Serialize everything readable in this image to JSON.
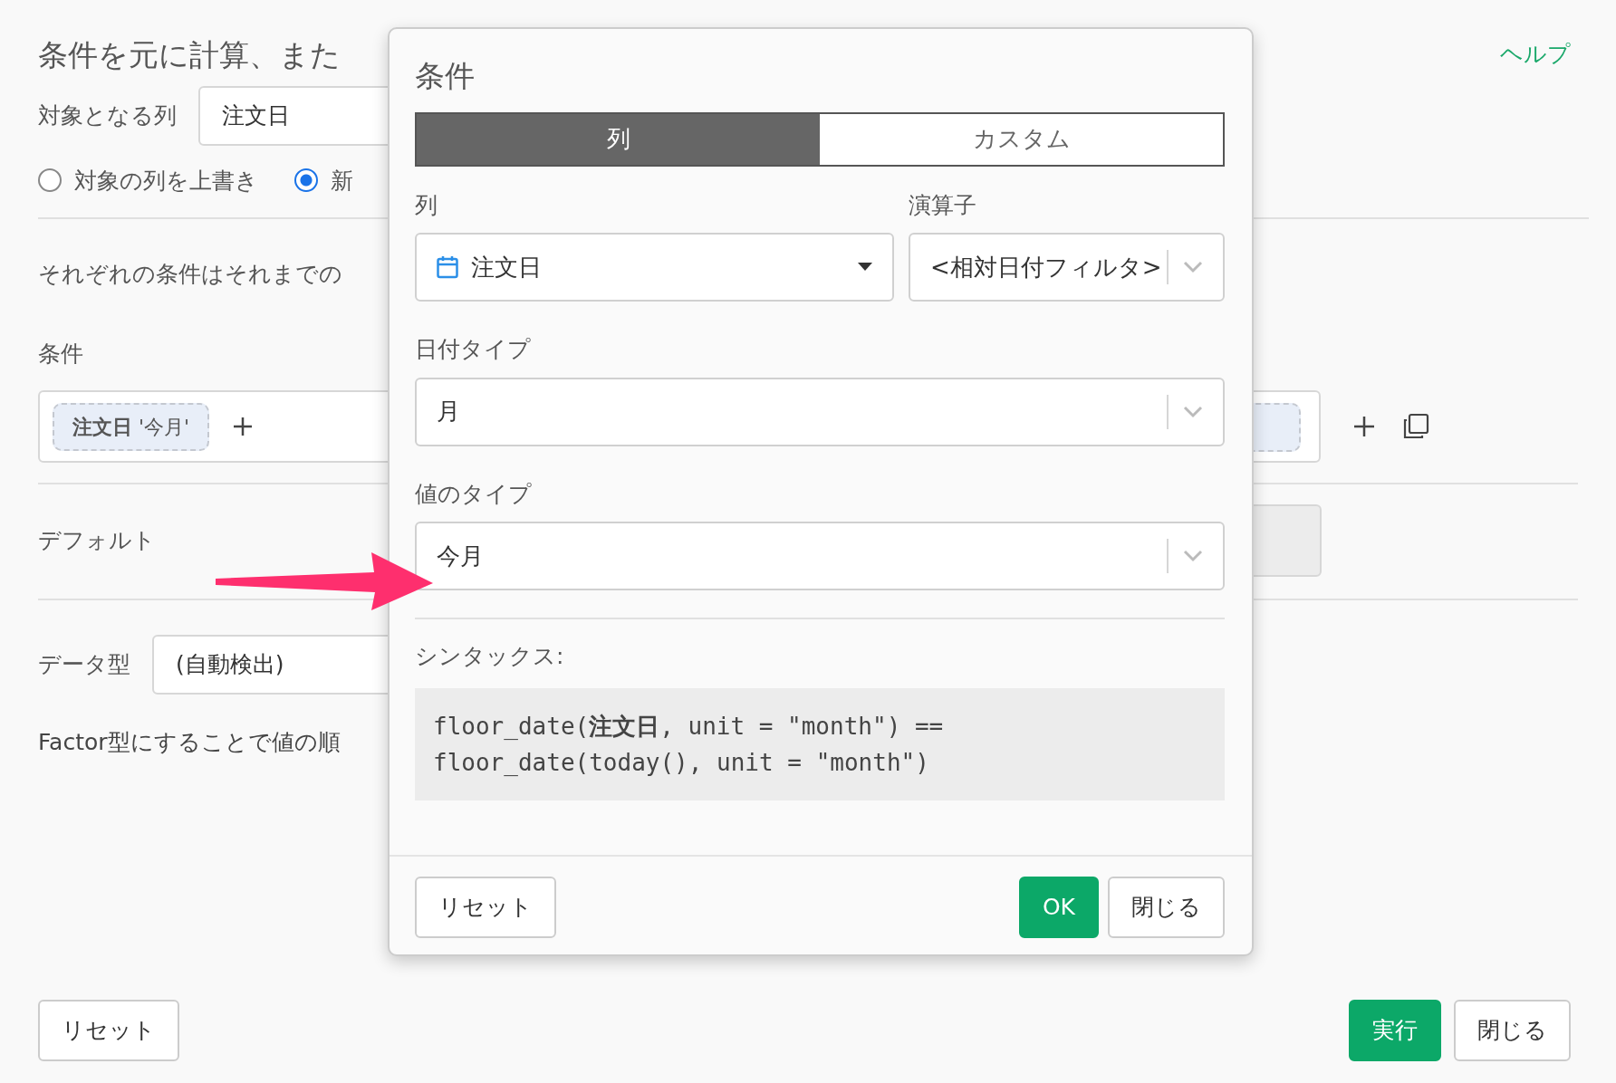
{
  "page": {
    "title": "条件を元に計算、また",
    "help_link": "ヘルプ",
    "target_column": {
      "label": "対象となる列",
      "value": "注文日"
    },
    "output_options": [
      {
        "label": "対象の列を上書き",
        "selected": false
      },
      {
        "label": "新",
        "selected": true
      }
    ],
    "description": "それぞれの条件はそれまでの",
    "conditions": {
      "label": "条件",
      "chips": [
        {
          "text": "**注文日** '今月'"
        }
      ]
    },
    "default": {
      "label": "デフォルト"
    },
    "data_type": {
      "label": "データ型",
      "value": "(自動検出)"
    },
    "factor_note": "Factor型にすることで値の順",
    "buttons": [
      {
        "label": "リセット",
        "kind": "secondary"
      },
      {
        "label": "実行",
        "kind": "primary"
      },
      {
        "label": "閉じる",
        "kind": "secondary"
      }
    ]
  },
  "dialog": {
    "title": "条件",
    "tabs": [
      {
        "label": "列",
        "selected": true
      },
      {
        "label": "カスタム",
        "selected": false
      }
    ],
    "column": {
      "label": "列",
      "value": "注文日"
    },
    "operator": {
      "label": "演算子",
      "value": "<相対日付フィルタ>"
    },
    "date_type": {
      "label": "日付タイプ",
      "value": "月"
    },
    "value_type": {
      "label": "値のタイプ",
      "value": "今月"
    },
    "syntax": {
      "label": "シンタックス:",
      "lines": [
        "floor_date(**注文日**, unit = \"month\") ==",
        "floor_date(today(), unit = \"month\")"
      ]
    },
    "buttons": [
      {
        "label": "リセット",
        "kind": "secondary"
      },
      {
        "label": "OK",
        "kind": "primary"
      },
      {
        "label": "閉じる",
        "kind": "secondary"
      }
    ]
  }
}
